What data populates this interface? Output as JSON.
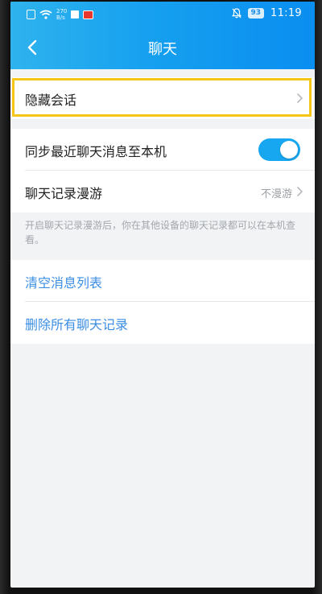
{
  "status_bar": {
    "speed_value": "270",
    "speed_unit": "B/s",
    "battery": "93",
    "time": "11:19"
  },
  "nav": {
    "title": "聊天",
    "back_icon": "chevron-left-icon"
  },
  "section1": {
    "hide_conversation_label": "隐藏会话"
  },
  "section2": {
    "sync_label": "同步最近聊天消息至本机",
    "sync_enabled": true,
    "roaming_label": "聊天记录漫游",
    "roaming_value": "不漫游",
    "hint": "开启聊天记录漫游后，你在其他设备的聊天记录都可以在本机查看。"
  },
  "section3": {
    "clear_list_label": "清空消息列表",
    "delete_all_label": "删除所有聊天记录"
  },
  "colors": {
    "header_start": "#2fb3ee",
    "header_end": "#0a8ef0",
    "accent": "#17a7f0",
    "link": "#3b8ee3",
    "highlight": "#f5c518",
    "background": "#f2f3f5"
  }
}
